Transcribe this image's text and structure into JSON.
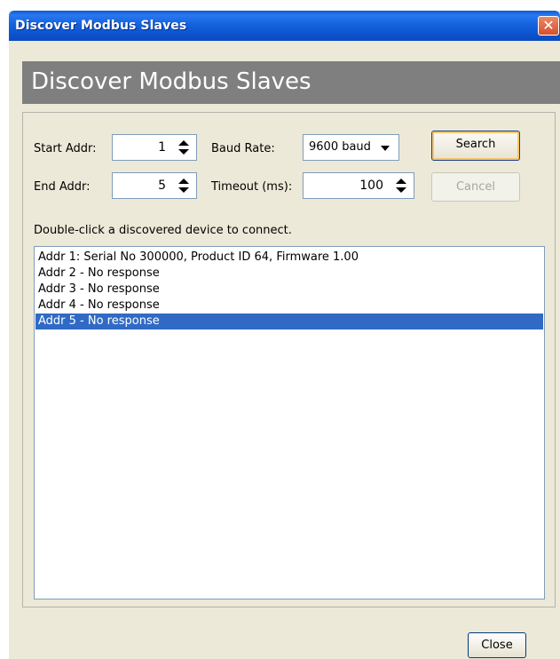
{
  "window": {
    "title": "Discover Modbus Slaves"
  },
  "header": {
    "title": "Discover Modbus Slaves"
  },
  "form": {
    "start_addr": {
      "label": "Start Addr:",
      "value": "1"
    },
    "end_addr": {
      "label": "End Addr:",
      "value": "5"
    },
    "baud_rate": {
      "label": "Baud Rate:",
      "value": "9600 baud"
    },
    "timeout": {
      "label": "Timeout (ms):",
      "value": "100"
    }
  },
  "buttons": {
    "search": "Search",
    "cancel": "Cancel",
    "close": "Close"
  },
  "instruction": "Double-click a discovered device to connect.",
  "devices": [
    "Addr 1: Serial No 300000, Product ID 64, Firmware 1.00",
    "Addr 2 - No response",
    "Addr 3 - No response",
    "Addr 4 - No response",
    "Addr 5 - No response"
  ],
  "selected_device_index": 4,
  "colors": {
    "titlebar": "#0a5cd8",
    "header_band": "#7f7f7f",
    "selection": "#316ac5",
    "dialog_bg": "#ece9d8"
  }
}
